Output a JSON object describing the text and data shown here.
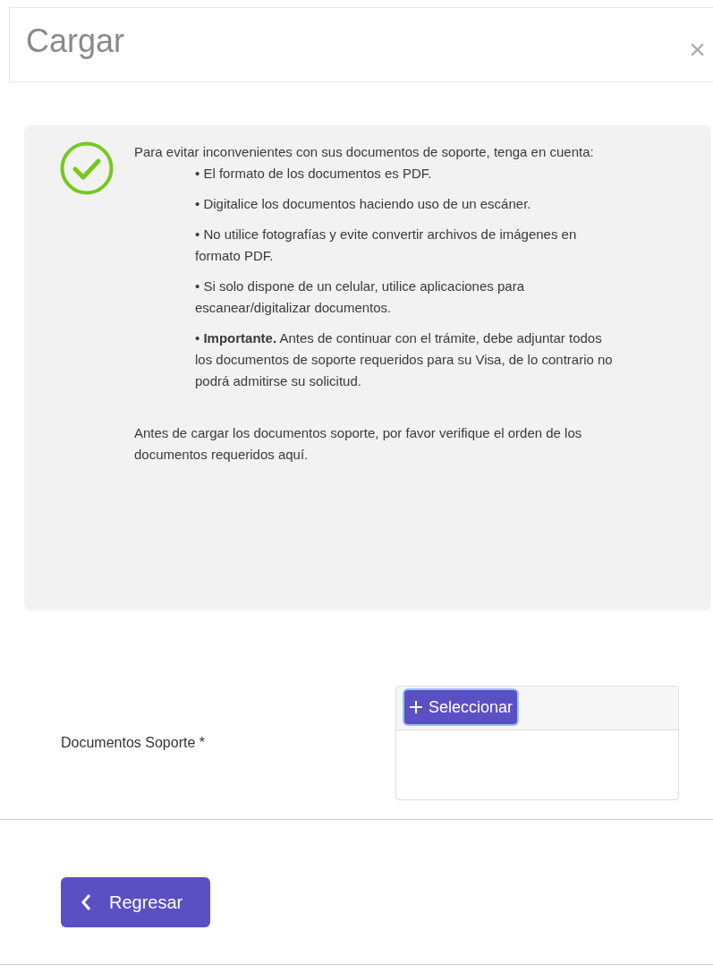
{
  "dialog": {
    "title": "Cargar",
    "close": "×"
  },
  "notice": {
    "intro": "Para evitar inconvenientes con sus documentos de soporte, tenga en cuenta:",
    "bullets": [
      "• El formato de los documentos es PDF.",
      "• Digitalice los documentos haciendo uso de un escáner.",
      "• No utilice fotografías y evite convertir archivos de imágenes en formato PDF.",
      "• Si solo dispone de un celular, utilice aplicaciones para escanear/digitalizar documentos.",
      "• **Importante.** Antes de continuar con el trámite, debe adjuntar todos los documentos de soporte requeridos para su Visa, de lo contrario no podrá admitirse su solicitud."
    ],
    "footer": "Antes de cargar los documentos soporte, por favor verifique el orden de los documentos requeridos aquí."
  },
  "field": {
    "label": "Documentos Soporte *",
    "button": "Seleccionar"
  },
  "back_button": "Regresar"
}
